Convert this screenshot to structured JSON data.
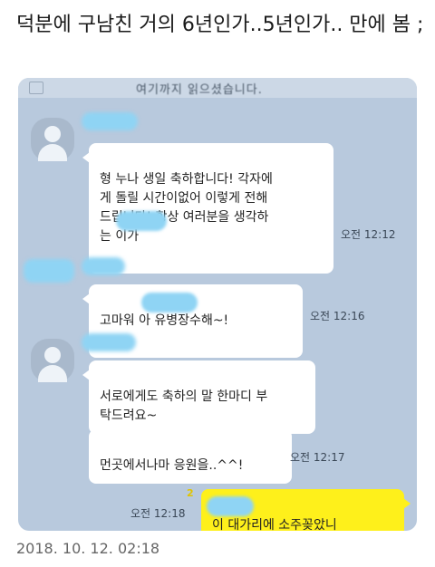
{
  "post": {
    "title": "덕분에 구남친 거의 6년인가..5년인가.. 만에 봄 ;",
    "date": "2018. 10. 12. 02:18"
  },
  "chat": {
    "notice_text": "여기까지 읽으셨습니다.",
    "messages": [
      {
        "text": "형 누나 생일 축하합니다! 각자에\n게 돌릴 시간이없어 이렇게 전해\n드립니다! 항상 여러분을 생각하\n는         이가",
        "time": "오전 12:12"
      },
      {
        "text": "고마워          아 유병장수해~!",
        "time": "오전 12:16"
      },
      {
        "text": "서로에게도 축하의 말 한마디 부\n탁드려요~",
        "time": ""
      },
      {
        "text": "먼곳에서나마 응원을..^^!",
        "time": "오전 12:17"
      },
      {
        "text": "          이 대가리에 소주꽂았니",
        "time": "오전 12:18",
        "unread": "2"
      }
    ]
  },
  "colors": {
    "chat_background": "#b8c9dd",
    "my_bubble": "#fef01b",
    "their_bubble": "#ffffff",
    "redaction": "#8fd4f4"
  }
}
